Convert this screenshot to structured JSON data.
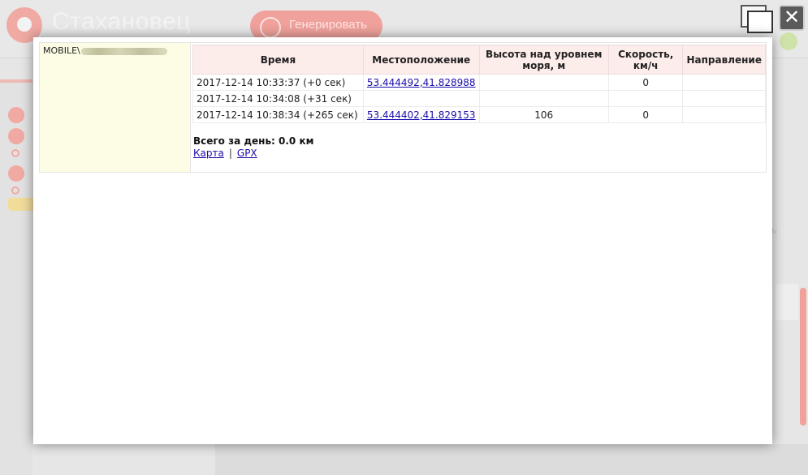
{
  "background_app": {
    "title": "Стахановец",
    "generate_button": "Генерировать",
    "right_text": "ь"
  },
  "window_controls": {
    "restore_icon": "window-restore-icon",
    "close_icon": "close-icon",
    "close_glyph": "✕"
  },
  "modal": {
    "user_prefix": "MOBILE\\",
    "user_name_blurred": true,
    "table": {
      "headers": {
        "time": "Время",
        "location": "Местоположение",
        "altitude": "Высота над уровнем моря, м",
        "speed": "Скорость, км/ч",
        "direction": "Направление"
      },
      "rows": [
        {
          "time": "2017-12-14 10:33:37 (+0 сек)",
          "location": "53.444492,41.828988",
          "altitude": "",
          "speed": "0",
          "direction": ""
        },
        {
          "time": "2017-12-14 10:34:08 (+31 сек)",
          "location": "",
          "altitude": "",
          "speed": "",
          "direction": ""
        },
        {
          "time": "2017-12-14 10:38:34 (+265 сек)",
          "location": "53.444402,41.829153",
          "altitude": "106",
          "speed": "0",
          "direction": ""
        }
      ]
    },
    "summary": {
      "total": "Всего за день: 0.0 км",
      "map_link": "Карта",
      "separator": "|",
      "gpx_link": "GPX"
    }
  },
  "colors": {
    "header_bg": "#fcecea",
    "user_cell_bg": "#fdfde6",
    "link": "#1a0dab",
    "accent_bg": "#f1a19c"
  }
}
